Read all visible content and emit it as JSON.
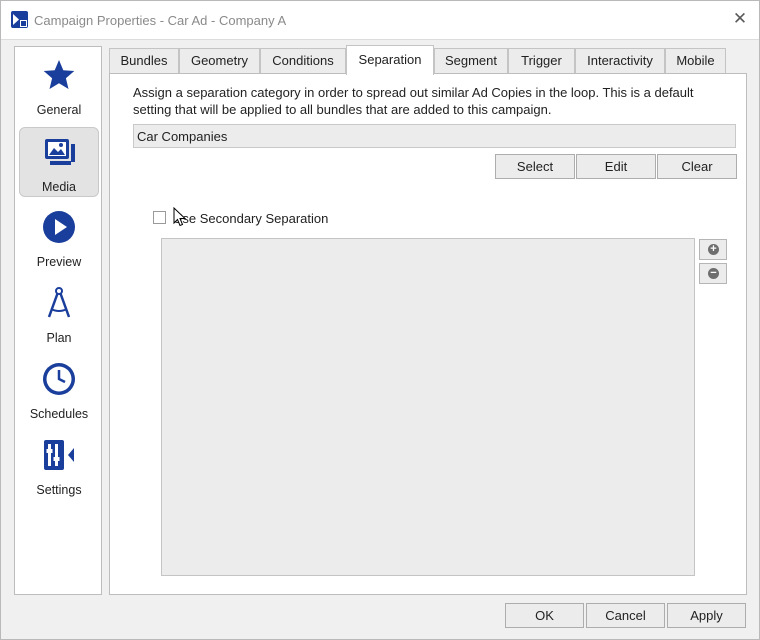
{
  "window": {
    "title": "Campaign Properties - Car Ad - Company A",
    "close_glyph": "✕"
  },
  "sidebar": {
    "items": [
      {
        "label": "General",
        "icon": "star-icon",
        "active": false
      },
      {
        "label": "Media",
        "icon": "media-icon",
        "active": true
      },
      {
        "label": "Preview",
        "icon": "play-icon",
        "active": false
      },
      {
        "label": "Plan",
        "icon": "compass-icon",
        "active": false
      },
      {
        "label": "Schedules",
        "icon": "clock-icon",
        "active": false
      },
      {
        "label": "Settings",
        "icon": "settings-panel-icon",
        "active": false
      }
    ]
  },
  "tabs": [
    {
      "label": "Bundles"
    },
    {
      "label": "Geometry"
    },
    {
      "label": "Conditions"
    },
    {
      "label": "Separation"
    },
    {
      "label": "Segment"
    },
    {
      "label": "Trigger"
    },
    {
      "label": "Interactivity"
    },
    {
      "label": "Mobile"
    }
  ],
  "active_tab": "Separation",
  "separation": {
    "description": "Assign a separation category in order to spread out similar Ad Copies in the loop. This is a default setting that will be applied to all bundles that are added to this campaign.",
    "category_value": "Car Companies",
    "select_label": "Select",
    "edit_label": "Edit",
    "clear_label": "Clear",
    "secondary_label": "Use Secondary Separation",
    "secondary_checked": false,
    "add_glyph": "+",
    "remove_glyph": "−"
  },
  "footer": {
    "ok_label": "OK",
    "cancel_label": "Cancel",
    "apply_label": "Apply"
  },
  "colors": {
    "accent": "#1745c2",
    "icon_blue": "#1a3e9b"
  }
}
